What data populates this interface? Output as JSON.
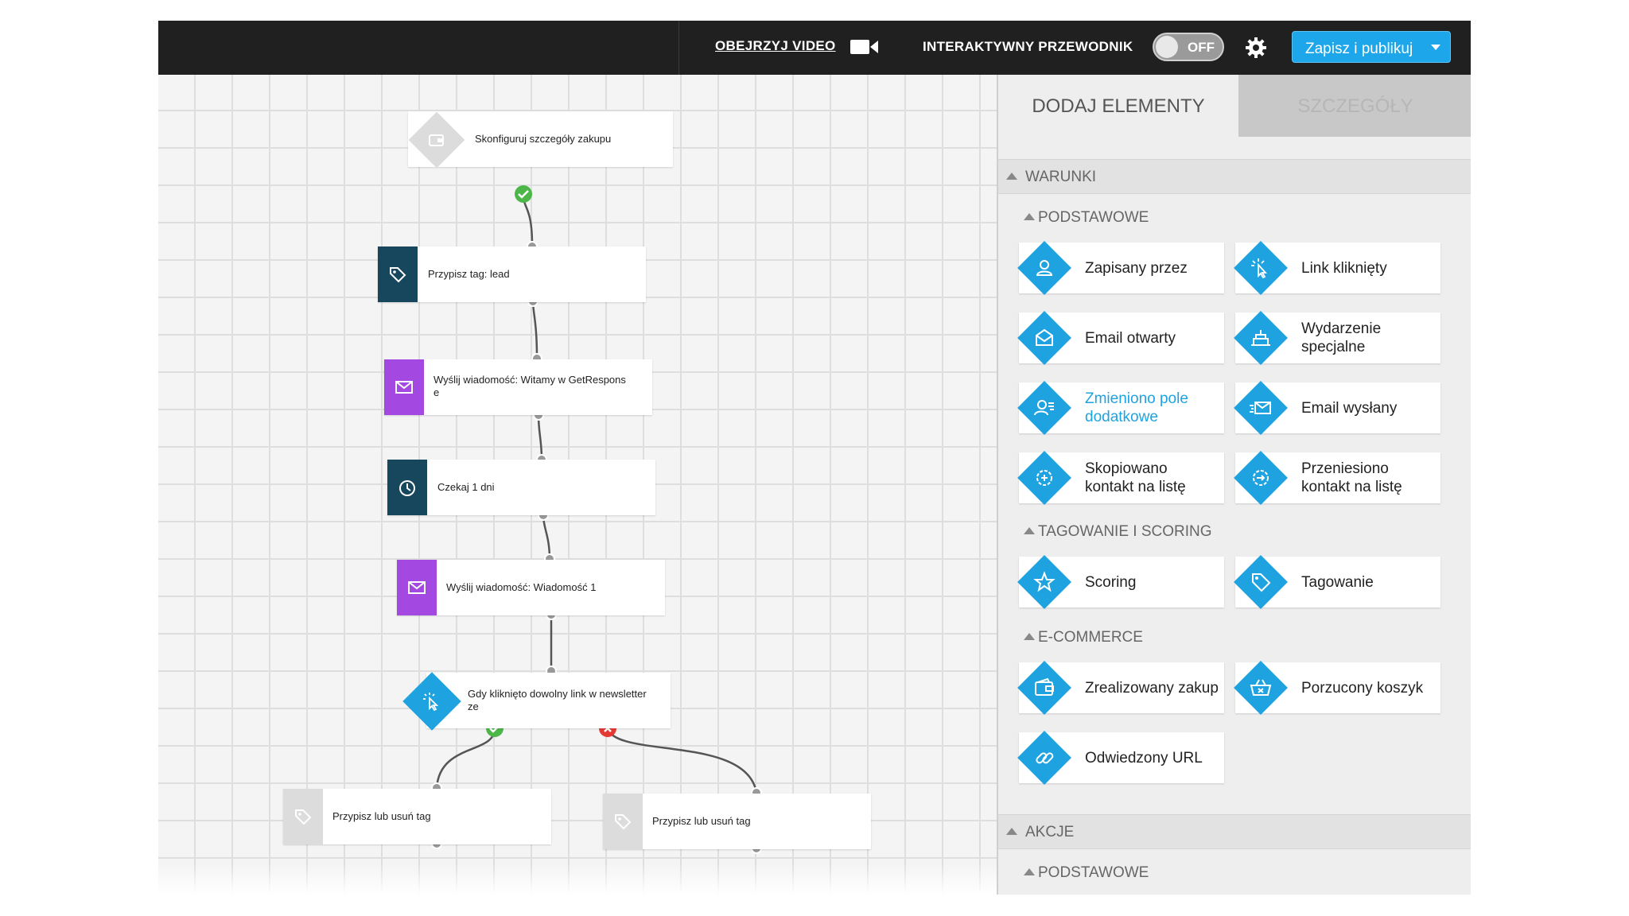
{
  "topbar": {
    "video_label": "OBEJRZYJ VIDEO",
    "guide_label": "INTERAKTYWNY PRZEWODNIK",
    "toggle_state": "OFF",
    "publish_label": "Zapisz i publikuj",
    "accent": "#1fa3e0"
  },
  "workflow": {
    "nodes": [
      {
        "label": "Skonfiguruj szczegóły zakupu",
        "icon": "wallet-icon"
      },
      {
        "label": "Przypisz tag: lead",
        "icon": "tag-icon"
      },
      {
        "label": "Wyślij wiadomość: Witamy w GetRespons\ne",
        "icon": "envelope-icon"
      },
      {
        "label": "Czekaj 1 dni",
        "icon": "clock-icon"
      },
      {
        "label": "Wyślij wiadomość: Wiadomość 1",
        "icon": "envelope-icon"
      },
      {
        "label": "Gdy kliknięto dowolny link w newsletter\nze",
        "icon": "cursor-click-icon"
      },
      {
        "label": "Przypisz lub usuń tag",
        "icon": "tag-icon"
      },
      {
        "label": "Przypisz lub usuń tag",
        "icon": "tag-icon"
      }
    ]
  },
  "panel": {
    "tabs": [
      "DODAJ ELEMENTY",
      "SZCZEGÓŁY"
    ],
    "section_conditions": "WARUNKI",
    "sub_basic": "PODSTAWOWE",
    "sub_tagging": "TAGOWANIE I SCORING",
    "sub_ecommerce": "E-COMMERCE",
    "section_actions": "AKCJE",
    "sub_basic_actions": "PODSTAWOWE",
    "basic_items": [
      {
        "label": "Zapisany przez",
        "icon": "user-icon"
      },
      {
        "label": "Link kliknięty",
        "icon": "cursor-click-icon"
      },
      {
        "label": "Email otwarty",
        "icon": "open-envelope-icon"
      },
      {
        "label": "Wydarzenie specjalne",
        "icon": "cake-icon"
      },
      {
        "label": "Zmieniono pole dodatkowe",
        "icon": "user-edit-icon"
      },
      {
        "label": "Email wysłany",
        "icon": "sent-envelope-icon"
      },
      {
        "label": "Skopiowano kontakt na listę",
        "icon": "copy-gear-icon"
      },
      {
        "label": "Przeniesiono kontakt na listę",
        "icon": "move-gear-icon"
      }
    ],
    "tagging_items": [
      {
        "label": "Scoring",
        "icon": "star-icon"
      },
      {
        "label": "Tagowanie",
        "icon": "tag-icon"
      }
    ],
    "ecommerce_items": [
      {
        "label": "Zrealizowany zakup",
        "icon": "wallet-icon"
      },
      {
        "label": "Porzucony koszyk",
        "icon": "basket-icon"
      },
      {
        "label": "Odwiedzony URL",
        "icon": "link-icon"
      }
    ]
  }
}
